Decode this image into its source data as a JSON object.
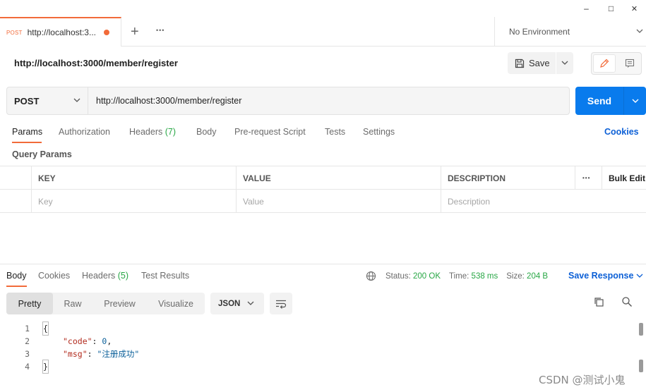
{
  "window": {
    "minimize": "–",
    "maximize": "□",
    "close": "✕"
  },
  "tabs": {
    "active": {
      "method": "POST",
      "name": "http://localhost:3...",
      "unsaved": true
    },
    "new_tab": "+",
    "more": "•••",
    "environment": "No Environment"
  },
  "request": {
    "title": "http://localhost:3000/member/register",
    "save_label": "Save",
    "method": "POST",
    "url": "http://localhost:3000/member/register",
    "send_label": "Send"
  },
  "request_tabs": [
    {
      "label": "Params",
      "count": ""
    },
    {
      "label": "Authorization",
      "count": ""
    },
    {
      "label": "Headers",
      "count": "(7)"
    },
    {
      "label": "Body",
      "count": ""
    },
    {
      "label": "Pre-request Script",
      "count": ""
    },
    {
      "label": "Tests",
      "count": ""
    },
    {
      "label": "Settings",
      "count": ""
    }
  ],
  "cookies_link": "Cookies",
  "query_params": {
    "title": "Query Params",
    "headers": [
      "KEY",
      "VALUE",
      "DESCRIPTION"
    ],
    "more": "•••",
    "bulk_edit": "Bulk Edit",
    "placeholders": [
      "Key",
      "Value",
      "Description"
    ]
  },
  "response_tabs": [
    {
      "label": "Body",
      "count": ""
    },
    {
      "label": "Cookies",
      "count": ""
    },
    {
      "label": "Headers",
      "count": "(5)"
    },
    {
      "label": "Test Results",
      "count": ""
    }
  ],
  "response_status": {
    "status_label": "Status:",
    "status_value": "200 OK",
    "time_label": "Time:",
    "time_value": "538 ms",
    "size_label": "Size:",
    "size_value": "204 B",
    "save_response": "Save Response"
  },
  "view_modes": [
    "Pretty",
    "Raw",
    "Preview",
    "Visualize"
  ],
  "format": "JSON",
  "code": {
    "line_numbers": [
      "1",
      "2",
      "3",
      "4"
    ],
    "open": "{",
    "code_key": "\"code\"",
    "code_value": "0",
    "msg_key": "\"msg\"",
    "msg_value": "\"注册成功\"",
    "close": "}"
  },
  "watermark": "CSDN @测试小鬼",
  "colors": {
    "accent": "#f26b3a",
    "send": "#097bed",
    "link": "#0b5fd6",
    "success": "#28a745"
  }
}
